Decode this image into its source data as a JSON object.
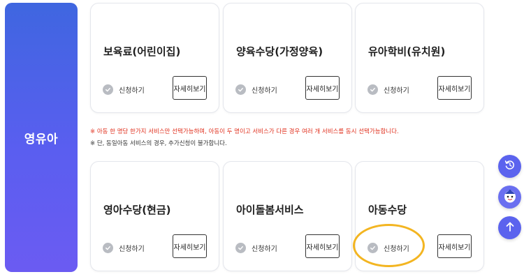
{
  "sidebar": {
    "label": "영유아"
  },
  "cards": [
    {
      "title": "보육료(어린이집)",
      "apply_label": "신청하기",
      "detail_label": "자세히보기"
    },
    {
      "title": "양육수당(가정양육)",
      "apply_label": "신청하기",
      "detail_label": "자세히보기"
    },
    {
      "title": "유아학비(유치원)",
      "apply_label": "신청하기",
      "detail_label": "자세히보기"
    },
    {
      "title": "영아수당(현금)",
      "apply_label": "신청하기",
      "detail_label": "자세히보기"
    },
    {
      "title": "아이돌봄서비스",
      "apply_label": "신청하기",
      "detail_label": "자세히보기"
    },
    {
      "title": "아동수당",
      "apply_label": "신청하기",
      "detail_label": "자세히보기"
    }
  ],
  "notices": {
    "line1": "※ 아동 한 명당 한가지 서비스만 선택가능하며, 아동이 두 명이고 서비스가 다른 경우 여러 개 서비스를 동시 선택가능합니다.",
    "line2": "※ 단, 동일아동 서비스의 경우, 추가신청이 불가합니다."
  },
  "floating_buttons": [
    {
      "icon": "history-icon"
    },
    {
      "icon": "mascot-icon"
    },
    {
      "icon": "arrow-up-icon"
    }
  ],
  "colors": {
    "sidebar_gradient_start": "#3f66e0",
    "sidebar_gradient_end": "#6b5bf2",
    "notice_red": "#e0301e",
    "highlight": "#f3b521",
    "fab": "#5b63ee"
  }
}
